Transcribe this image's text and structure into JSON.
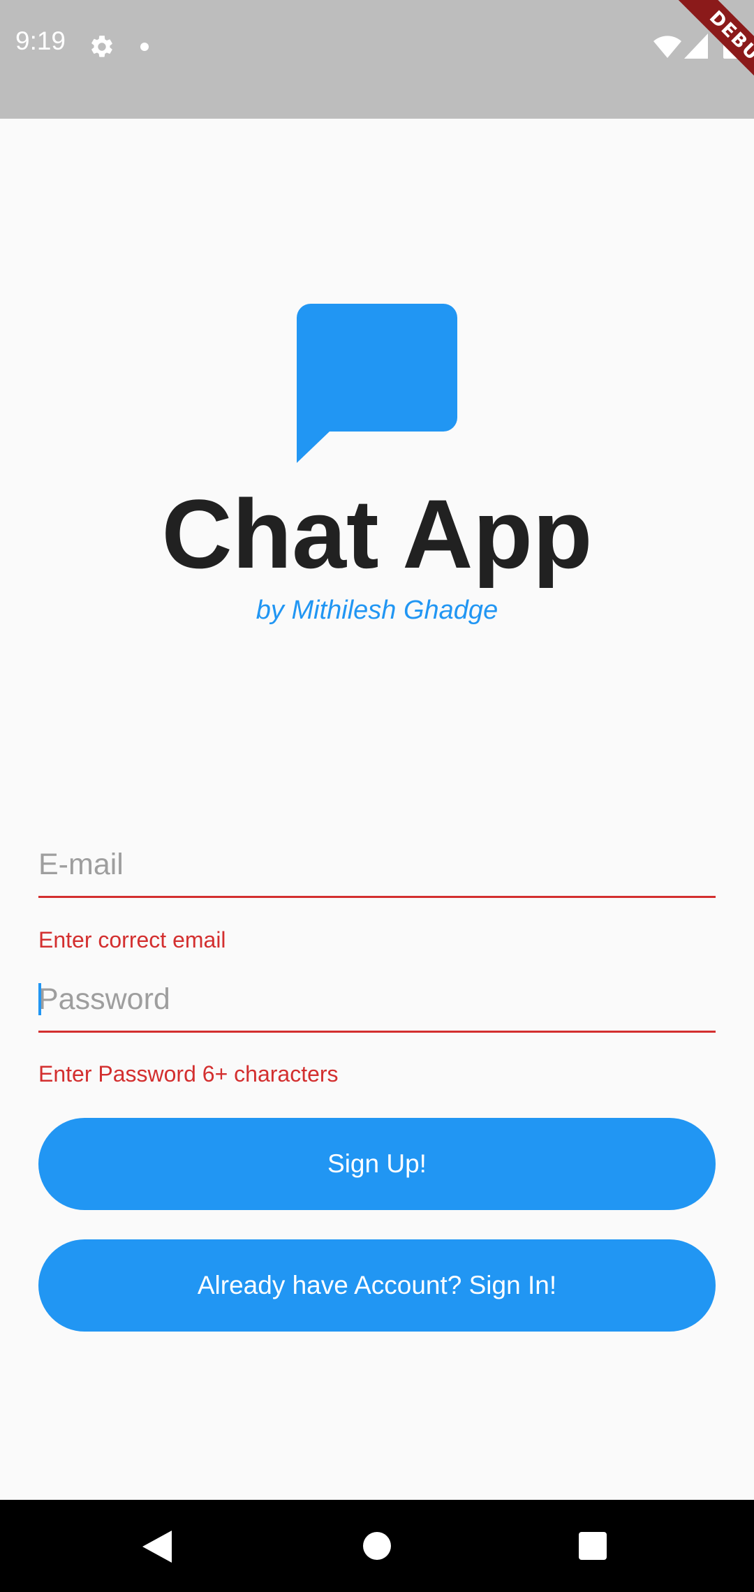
{
  "status_bar": {
    "time": "9:19",
    "icons": [
      "gear-icon",
      "notification-dot-icon",
      "wifi-icon",
      "signal-icon",
      "battery-icon"
    ]
  },
  "debug_banner": {
    "label": "DEBUG"
  },
  "logo": {
    "icon": "chat-bubble-icon",
    "title": "Chat App",
    "subtitle": "by Mithilesh Ghadge"
  },
  "form": {
    "email": {
      "placeholder": "E-mail",
      "value": "",
      "error": "Enter correct email"
    },
    "password": {
      "placeholder": "Password",
      "value": "",
      "error": "Enter Password 6+ characters"
    }
  },
  "buttons": {
    "signup": "Sign Up!",
    "signin": "Already have Account? Sign In!"
  },
  "nav_bar": {
    "icons": [
      "back-icon",
      "home-icon",
      "recents-icon"
    ]
  },
  "colors": {
    "accent": "#2196f3",
    "error": "#d32f2f",
    "status_bar": "#bdbdbd",
    "title": "#212121",
    "background": "#fafafa"
  }
}
